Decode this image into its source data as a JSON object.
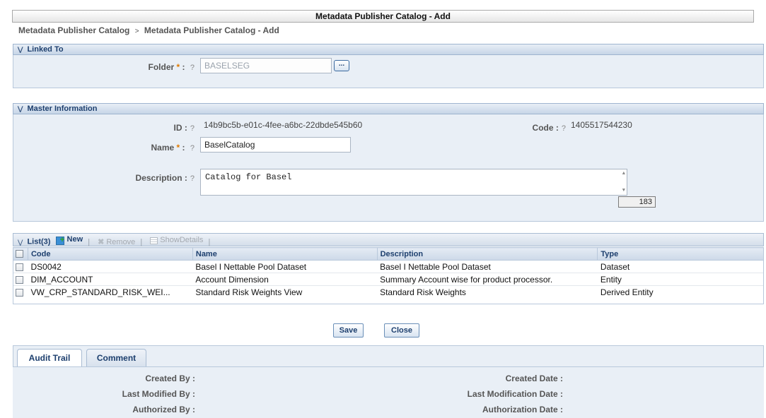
{
  "window": {
    "title": "Metadata Publisher Catalog - Add"
  },
  "breadcrumb": {
    "root": "Metadata Publisher Catalog",
    "separator": ">",
    "current": "Metadata Publisher Catalog - Add"
  },
  "linked_to": {
    "section_title": "Linked To",
    "folder_label": "Folder",
    "required_mark": "*",
    "colon": ":",
    "help": "?",
    "folder_value": "BASELSEG",
    "browse_label": "..."
  },
  "master": {
    "section_title": "Master Information",
    "id_label": "ID :",
    "id_value": "14b9bc5b-e01c-4fee-a6bc-22dbde545b60",
    "code_label": "Code :",
    "code_value": "1405517544230",
    "name_label": "Name",
    "name_value": "BaselCatalog",
    "description_label": "Description :",
    "description_value": "Catalog for Basel",
    "char_counter": "183",
    "help": "?",
    "required_mark": "*",
    "colon": ":"
  },
  "list": {
    "title": "List(3)",
    "new_label": "New",
    "remove_label": "Remove",
    "show_details_label": "ShowDetails",
    "separator": "|",
    "columns": [
      "Code",
      "Name",
      "Description",
      "Type"
    ],
    "rows": [
      {
        "code": "DS0042",
        "name": "Basel I Nettable Pool Dataset",
        "description": "Basel I Nettable Pool Dataset",
        "type": "Dataset"
      },
      {
        "code": "DIM_ACCOUNT",
        "name": "Account Dimension",
        "description": "Summary Account wise for product processor.",
        "type": "Entity"
      },
      {
        "code": "VW_CRP_STANDARD_RISK_WEI...",
        "name": "Standard Risk Weights View",
        "description": "Standard Risk Weights",
        "type": "Derived Entity"
      }
    ]
  },
  "actions": {
    "save_label": "Save",
    "close_label": "Close"
  },
  "audit": {
    "tabs": [
      "Audit Trail",
      "Comment"
    ],
    "active_tab": "Audit Trail",
    "created_by_label": "Created By :",
    "last_modified_by_label": "Last Modified By :",
    "authorized_by_label": "Authorized By :",
    "created_date_label": "Created Date :",
    "last_modification_date_label": "Last Modification Date :",
    "authorization_date_label": "Authorization Date :"
  },
  "colors": {
    "section_text": "#1d3f6e",
    "required": "#e07a00",
    "panel_bg": "#e9eff6"
  },
  "icons": [
    "chevron-down-icon",
    "new-icon",
    "remove-icon",
    "show-details-icon",
    "checkbox-icon",
    "scroll-arrow-icon"
  ]
}
